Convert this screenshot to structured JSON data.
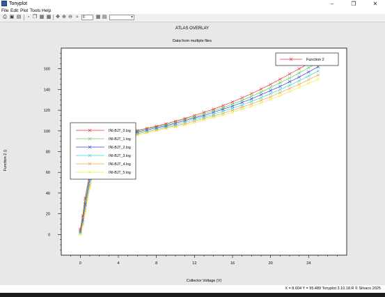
{
  "window": {
    "title": "Tonyplot",
    "minimize_glyph": "–",
    "restore_glyph": "❐",
    "close_glyph": "✕"
  },
  "menu": [
    "File",
    "Edit",
    "Plot",
    "Tools",
    "Help"
  ],
  "toolbar": {
    "zoom_value": "0"
  },
  "status": {
    "readout": "X = 8.604 Y = 95.489  Tonyplot 3.10.18.R © Silvaco 2025"
  },
  "colors": {
    "series": [
      "#e8313b",
      "#55d44f",
      "#3b3de0",
      "#37d4d4",
      "#f4a640",
      "#f0ec4a"
    ],
    "overlay_series": "#e8313b"
  },
  "chart_data": {
    "type": "line",
    "title": "ATLAS OVERLAY",
    "subtitle": "Data from multiple files",
    "xlabel": "Collector Voltage (V)",
    "ylabel": "Function 2 ()",
    "xlim": [
      -2,
      28
    ],
    "ylim": [
      -20,
      180
    ],
    "xticks": [
      0,
      4,
      8,
      12,
      16,
      20,
      24
    ],
    "yticks": [
      0,
      20,
      40,
      60,
      80,
      100,
      120,
      140,
      160
    ],
    "x": [
      0,
      0.25,
      0.5,
      1,
      1.5,
      2,
      2.5,
      3,
      4,
      5,
      6,
      7,
      8,
      9,
      10,
      11,
      12,
      13,
      14,
      15,
      16,
      17,
      18,
      19,
      20,
      21,
      22,
      23,
      24,
      25
    ],
    "series": [
      {
        "name": "Function 2",
        "values": [
          5,
          18,
          35,
          60,
          78,
          88,
          92,
          94,
          96.5,
          98.5,
          100.5,
          102.5,
          104.5,
          107,
          109.5,
          112,
          115,
          118,
          121,
          124.5,
          128,
          132,
          136,
          140.5,
          145,
          150,
          155,
          160,
          165,
          171
        ]
      },
      {
        "name": "INI-BJT_0.log",
        "values": [
          5,
          18,
          35,
          60,
          78,
          88,
          92,
          94,
          96.5,
          98.5,
          100.5,
          102.5,
          104.5,
          107,
          109.5,
          112,
          115,
          118,
          121,
          124.5,
          128,
          132,
          136,
          140.5,
          145,
          150,
          155,
          160,
          165,
          171
        ]
      },
      {
        "name": "INI-BJT_1.log",
        "values": [
          4,
          16,
          32,
          57,
          76,
          86,
          91,
          93.5,
          96,
          98,
          100,
          102,
          104,
          106,
          108.5,
          111,
          113.5,
          116.5,
          119.5,
          122.5,
          126,
          129.5,
          133.5,
          137.5,
          142,
          146.5,
          151,
          156,
          161,
          166
        ]
      },
      {
        "name": "INI-BJT_2.log",
        "values": [
          3,
          14,
          29,
          54,
          73,
          84,
          90,
          92.5,
          95,
          97,
          99,
          101,
          103,
          105,
          107.5,
          110,
          112.5,
          115,
          118,
          121,
          124,
          127.5,
          131,
          135,
          139,
          143,
          147.5,
          152,
          157,
          162
        ]
      },
      {
        "name": "INI-BJT_3.log",
        "values": [
          2,
          12,
          26,
          51,
          70,
          82,
          88.5,
          91.5,
          94,
          96,
          98,
          100,
          102,
          104,
          106,
          108.5,
          111,
          113.5,
          116,
          119,
          122,
          125,
          128.5,
          132,
          136,
          140,
          144,
          148.5,
          153,
          158
        ]
      },
      {
        "name": "INI-BJT_4.log",
        "values": [
          1,
          10,
          23,
          48,
          67,
          80,
          87,
          90.5,
          93,
          95,
          97,
          99,
          101,
          103,
          105,
          107,
          109.5,
          112,
          114.5,
          117,
          120,
          123,
          126,
          129.5,
          133,
          137,
          141,
          145,
          149.5,
          154
        ]
      },
      {
        "name": "INI-BJT_5.log",
        "values": [
          0,
          8,
          20,
          45,
          64,
          78,
          85.5,
          89.5,
          92,
          94,
          96,
          98,
          100,
          102,
          104,
          106,
          108,
          110.5,
          113,
          115.5,
          118,
          121,
          124,
          127,
          130.5,
          134,
          138,
          142,
          146,
          150
        ]
      }
    ],
    "legends": [
      {
        "placement": "top-right",
        "entries": [
          "Function 2"
        ]
      },
      {
        "placement": "left",
        "entries": [
          "INI-BJT_0.log",
          "INI-BJT_1.log",
          "INI-BJT_2.log",
          "INI-BJT_3.log",
          "INI-BJT_4.log",
          "INI-BJT_5.log"
        ]
      }
    ],
    "grid": false
  }
}
